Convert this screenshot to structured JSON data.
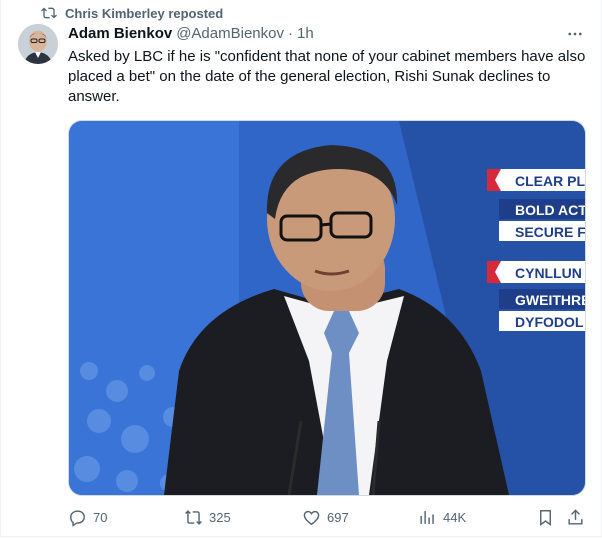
{
  "repost": {
    "label": "Chris Kimberley reposted"
  },
  "tweet": {
    "author_name": "Adam Bienkov",
    "handle": "@AdamBienkov",
    "separator": "·",
    "time": "1h",
    "text": "Asked by LBC if he is \"confident that none of your cabinet members have also placed a bet\" on the date of the general election, Rishi Sunak declines to answer."
  },
  "media": {
    "banner_lines": [
      "CLEAR PLAN",
      "BOLD ACTI",
      "SECURE F",
      "CYNLLUN CL",
      "GWEITHRE",
      "DYFODOL"
    ]
  },
  "actions": {
    "replies": "70",
    "reposts": "325",
    "likes": "697",
    "views": "44K"
  },
  "colors": {
    "secondary_text": "#536471",
    "backdrop_blue": "#2f66c8",
    "panel_blue": "#2552a6",
    "banner_red": "#d62a3a"
  }
}
